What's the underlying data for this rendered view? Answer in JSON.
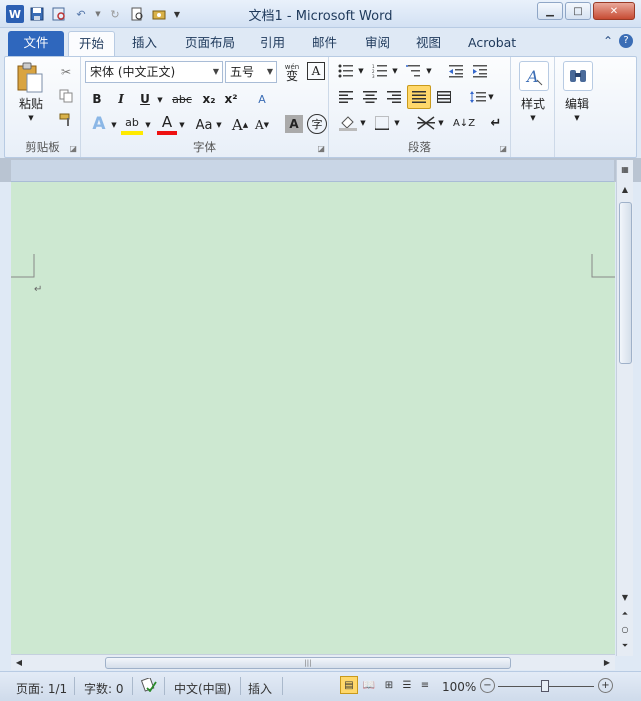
{
  "window": {
    "title": "文档1  -  Microsoft Word"
  },
  "tabs": {
    "file": "文件",
    "home": "开始",
    "insert": "插入",
    "page_layout": "页面布局",
    "references": "引用",
    "mailings": "邮件",
    "review": "审阅",
    "view": "视图",
    "acrobat": "Acrobat"
  },
  "ribbon": {
    "clipboard": {
      "paste_label": "粘贴",
      "group_label": "剪贴板"
    },
    "font": {
      "font_name": "宋体 (中文正文)",
      "font_size": "五号",
      "wen_label": "wén",
      "wen_char": "变",
      "border_a": "A",
      "bold": "B",
      "italic": "I",
      "underline": "U",
      "strike": "abc",
      "subscript": "x₂",
      "superscript": "x²",
      "clear_label": "A",
      "effect_label": "A",
      "highlight_label": "ab",
      "color_label": "A",
      "case_label": "Aa",
      "grow_label": "A",
      "shrink_label": "A",
      "shade_label": "A",
      "enclose_label": "字",
      "group_label": "字体"
    },
    "paragraph": {
      "sort_label": "A↓Z",
      "group_label": "段落"
    },
    "styles": {
      "label": "样式"
    },
    "editing": {
      "label": "编辑"
    }
  },
  "document": {
    "paragraph_mark": "↵"
  },
  "statusbar": {
    "page": "页面: 1/1",
    "words": "字数: 0",
    "language": "中文(中国)",
    "mode": "插入",
    "zoom": "100%"
  }
}
